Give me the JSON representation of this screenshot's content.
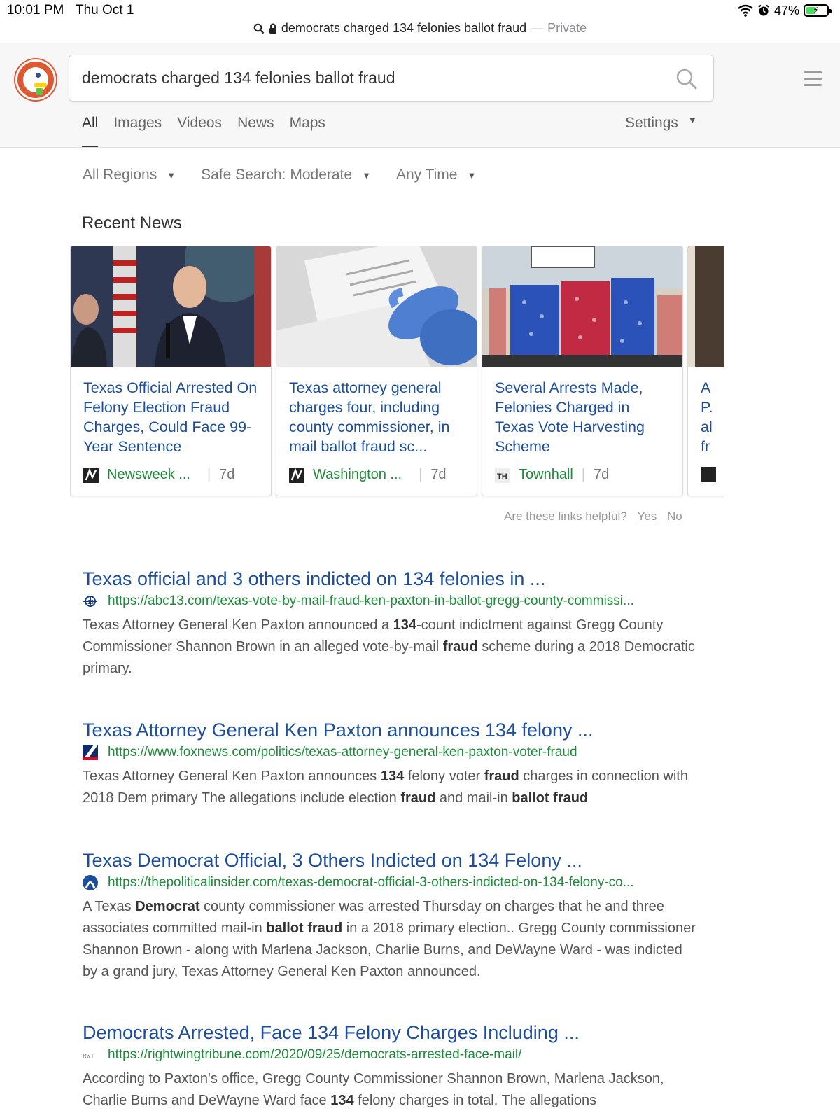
{
  "status_bar": {
    "time": "10:01 PM",
    "date": "Thu Oct 1",
    "battery": "47%",
    "battery_level": 0.47
  },
  "browser": {
    "url_text": "democrats charged 134 felonies ballot fraud",
    "separator": "—",
    "mode": "Private"
  },
  "search": {
    "query": "democrats charged 134 felonies ballot fraud"
  },
  "tabs": [
    "All",
    "Images",
    "Videos",
    "News",
    "Maps"
  ],
  "settings_label": "Settings",
  "filters": [
    "All Regions",
    "Safe Search: Moderate",
    "Any Time"
  ],
  "recent_news": {
    "title": "Recent News",
    "cards": [
      {
        "title": "Texas Official Arrested On Felony Election Fraud Charges, Could Face 99-Year Sentence",
        "source": "Newsweek ...",
        "age": "7d"
      },
      {
        "title": "Texas attorney general charges four, including county commissioner, in mail ballot fraud sc...",
        "source": "Washington ...",
        "age": "7d"
      },
      {
        "title": "Several Arrests Made, Felonies Charged in Texas Vote Harvesting Scheme",
        "source": "Townhall",
        "age": "7d"
      },
      {
        "title": "A\nP.\nal\nfr",
        "source": "",
        "age": ""
      }
    ],
    "helpful_prompt": "Are these links helpful?",
    "yes": "Yes",
    "no": "No"
  },
  "results": [
    {
      "title": "Texas official and 3 others indicted on 134 felonies in ...",
      "url": "https://abc13.com/texas-vote-by-mail-fraud-ken-paxton-in-ballot-gregg-county-commissi...",
      "snippet": "Texas Attorney General Ken Paxton announced a <b>134</b>-count indictment against Gregg County Commissioner Shannon Brown in an alleged vote-by-mail <b>fraud</b> scheme during a 2018 Democratic primary."
    },
    {
      "title": "Texas Attorney General Ken Paxton announces 134 felony ...",
      "url": "https://www.foxnews.com/politics/texas-attorney-general-ken-paxton-voter-fraud",
      "snippet": "Texas Attorney General Ken Paxton announces <b>134</b> felony voter <b>fraud</b> charges in connection with 2018 Dem primary The allegations include election <b>fraud</b> and mail-in <b>ballot fraud</b>"
    },
    {
      "title": "Texas Democrat Official, 3 Others Indicted on 134 Felony ...",
      "url": "https://thepoliticalinsider.com/texas-democrat-official-3-others-indicted-on-134-felony-co...",
      "snippet": "A Texas <b>Democrat</b> county commissioner was arrested Thursday on charges that he and three associates committed mail-in <b>ballot fraud</b> in a 2018 primary election.. Gregg County commissioner Shannon Brown - along with Marlena Jackson, Charlie Burns, and DeWayne Ward - was indicted by a grand jury, Texas Attorney General Ken Paxton announced."
    },
    {
      "title": "Democrats Arrested, Face 134 Felony Charges Including ...",
      "url": "https://rightwingtribune.com/2020/09/25/democrats-arrested-face-mail/",
      "snippet": "According to Paxton's office, Gregg County Commissioner Shannon Brown, Marlena Jackson, Charlie Burns and DeWayne Ward face <b>134</b> felony charges in total. The allegations"
    }
  ],
  "colors": {
    "link": "#1c4e9c",
    "url": "#1e8a3a",
    "snippet": "#555555",
    "brand": "#de5833"
  }
}
